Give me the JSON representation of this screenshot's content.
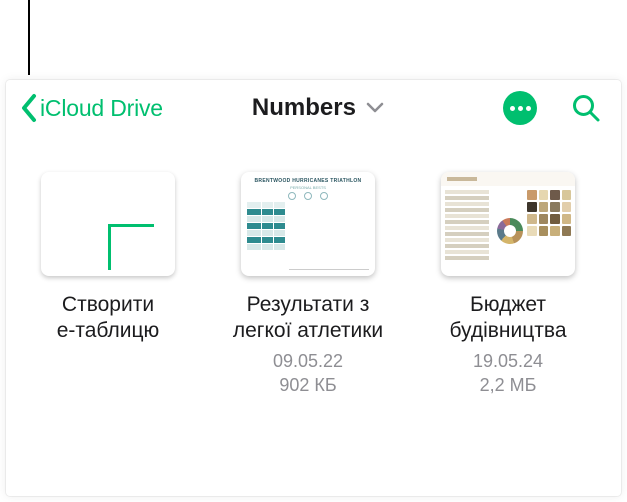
{
  "nav": {
    "back_label": "iCloud Drive",
    "title": "Numbers"
  },
  "items": [
    {
      "type": "create",
      "label": "Створити\nе-таблицю"
    },
    {
      "type": "file",
      "label": "Результати з легкої атлетики",
      "date": "09.05.22",
      "size": "902 КБ",
      "thumb_title": "BRENTWOOD HURRICANES TRIATHLON",
      "thumb_subtitle": "PERSONAL BESTS"
    },
    {
      "type": "file",
      "label": "Бюджет будівництва",
      "date": "19.05.24",
      "size": "2,2 МБ",
      "swatches": [
        "#c99a6a",
        "#e6d7b0",
        "#6e5a4a",
        "#d8c79a",
        "#3e362c",
        "#bda77a",
        "#8a7a5e",
        "#e2ceab",
        "#cfb88c",
        "#9e875f",
        "#715c3e",
        "#d0b786",
        "#e9dbb8",
        "#a88f5e",
        "#c8af7a",
        "#8f7954"
      ]
    }
  ]
}
